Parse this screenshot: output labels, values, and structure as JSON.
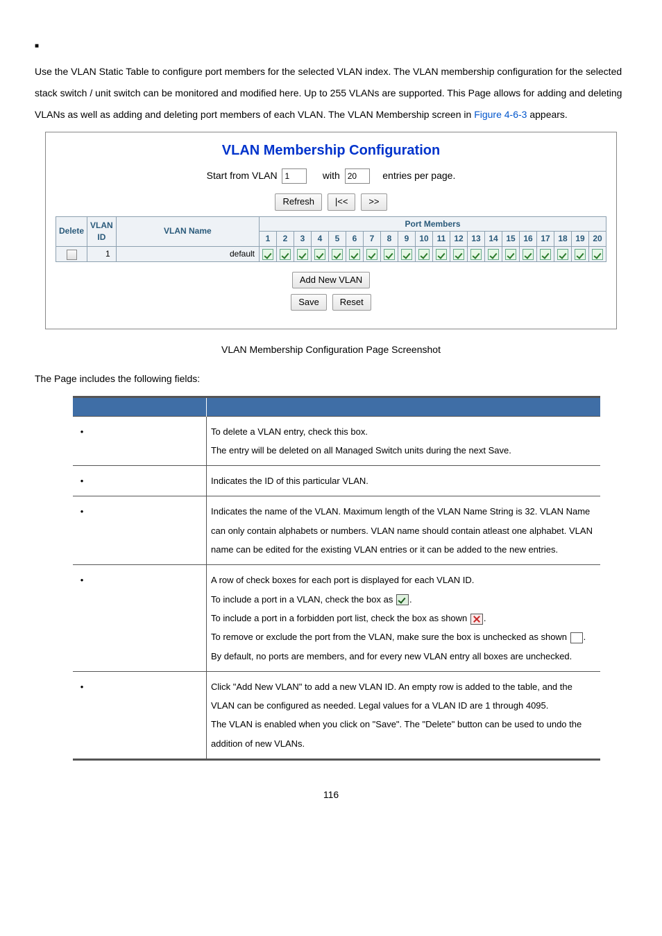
{
  "intro": {
    "lone_bullet": "■",
    "paragraph_pre": "Use the VLAN Static Table to configure port members for the selected VLAN index. The VLAN membership configuration for the selected stack switch / unit switch can be monitored and modified here. Up to 255 VLANs are supported. This Page allows for adding and deleting VLANs as well as adding and deleting port members of each VLAN. The VLAN Membership screen in ",
    "figure_ref": "Figure 4-6-3",
    "paragraph_post": " appears."
  },
  "screenshot": {
    "title": "VLAN Membership Configuration",
    "start_label": "Start from VLAN",
    "start_value": "1",
    "with_label": "with",
    "perpage_value": "20",
    "entries_label": "entries per page.",
    "btn_refresh": "Refresh",
    "btn_first": "|<<",
    "btn_next": ">>",
    "headers": {
      "delete": "Delete",
      "vlan_id": "VLAN ID",
      "vlan_name": "VLAN Name",
      "port_members": "Port Members"
    },
    "port_numbers": [
      "1",
      "2",
      "3",
      "4",
      "5",
      "6",
      "7",
      "8",
      "9",
      "10",
      "11",
      "12",
      "13",
      "14",
      "15",
      "16",
      "17",
      "18",
      "19",
      "20"
    ],
    "row": {
      "vlan_id": "1",
      "vlan_name": "default"
    },
    "btn_add": "Add New VLAN",
    "btn_save": "Save",
    "btn_reset": "Reset"
  },
  "caption": "VLAN Membership Configuration Page Screenshot",
  "fields_intro": "The Page includes the following fields:",
  "fields": {
    "delete": {
      "l1": "To delete a VLAN entry, check this box.",
      "l2": "The entry will be deleted on all Managed Switch units during the next Save."
    },
    "vlan_id": "Indicates the ID of this particular VLAN.",
    "vlan_name": "Indicates the name of the VLAN. Maximum length of the VLAN Name String is 32. VLAN Name can only contain alphabets or numbers. VLAN name should contain atleast one alphabet. VLAN name can be edited for the existing VLAN entries or it can be added to the new entries.",
    "port_members": {
      "l1": "A row of check boxes for each port is displayed for each VLAN ID.",
      "l2a": "To include a port in a VLAN, check the box as ",
      "l2b": ".",
      "l3a": "To include a port in a forbidden port list, check the box as shown ",
      "l3b": ".",
      "l4a": "To remove or exclude the port from the VLAN, make sure the box is unchecked as shown ",
      "l4b": ".",
      "l5": "By default, no ports are members, and for every new VLAN entry all boxes are unchecked."
    },
    "add_new": {
      "l1": "Click \"Add New VLAN\" to add a new VLAN ID. An empty row is added to the table, and the VLAN can be configured as needed. Legal values for a VLAN ID are 1 through 4095.",
      "l2": "The VLAN is enabled when you click on \"Save\". The \"Delete\" button can be used to undo the addition of new VLANs."
    }
  },
  "page_number": "116"
}
